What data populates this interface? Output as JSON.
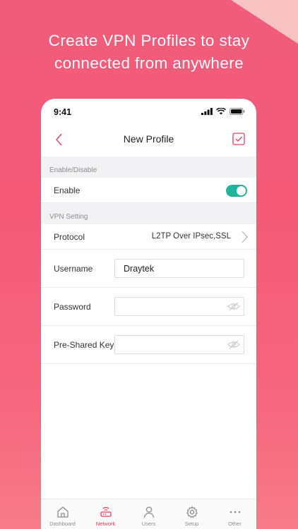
{
  "headline": {
    "line1": "Create VPN Profiles to stay",
    "line2": "connected from anywhere"
  },
  "status_bar": {
    "time": "9:41"
  },
  "nav": {
    "title": "New Profile",
    "back_icon": "chevron-left-icon",
    "save_icon": "checkbox-icon"
  },
  "sections": {
    "enable": {
      "header": "Enable/Disable",
      "enable_label": "Enable",
      "enable_on": true
    },
    "vpn": {
      "header": "VPN Setting",
      "protocol_label": "Protocol",
      "protocol_value": "L2TP Over IPsec,SSL",
      "username_label": "Username",
      "username_value": "Draytek",
      "password_label": "Password",
      "password_value": "",
      "psk_label": "Pre-Shared Key",
      "psk_value": ""
    }
  },
  "tabs": [
    {
      "label": "Dashboard",
      "icon": "home-icon",
      "active": false
    },
    {
      "label": "Network",
      "icon": "router-icon",
      "active": true
    },
    {
      "label": "Users",
      "icon": "user-icon",
      "active": false
    },
    {
      "label": "Setup",
      "icon": "gear-icon",
      "active": false
    },
    {
      "label": "Other",
      "icon": "more-icon",
      "active": false
    }
  ],
  "colors": {
    "accent": "#e8405f",
    "toggle_on": "#1fb59a",
    "background": "#f45a78"
  }
}
